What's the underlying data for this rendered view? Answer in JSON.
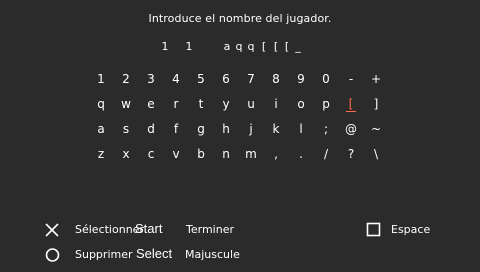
{
  "prompt": "Introduce el nombre del jugador.",
  "entry": {
    "characters": [
      "1",
      "1",
      "a",
      "q",
      "q",
      "[",
      "[",
      "[",
      "_"
    ]
  },
  "keyboard": {
    "rows": [
      [
        "1",
        "2",
        "3",
        "4",
        "5",
        "6",
        "7",
        "8",
        "9",
        "0",
        "-",
        "+"
      ],
      [
        "q",
        "w",
        "e",
        "r",
        "t",
        "y",
        "u",
        "i",
        "o",
        "p",
        "[",
        "]"
      ],
      [
        "a",
        "s",
        "d",
        "f",
        "g",
        "h",
        "j",
        "k",
        "l",
        ";",
        "@",
        "~"
      ],
      [
        "z",
        "x",
        "c",
        "v",
        "b",
        "n",
        "m",
        ",",
        ".",
        "/",
        "?",
        "\\"
      ]
    ],
    "selected": {
      "row": 1,
      "col": 10
    }
  },
  "legend": {
    "cross_label": "Sélectionner",
    "circle_label": "Supprimer",
    "start_word": "Start",
    "start_label": "Terminer",
    "select_word": "Select",
    "select_label": "Majuscule",
    "square_label": "Espace"
  },
  "colors": {
    "background": "#2b2b2b",
    "text": "#ffffff",
    "highlight": "#ff6a4a"
  }
}
